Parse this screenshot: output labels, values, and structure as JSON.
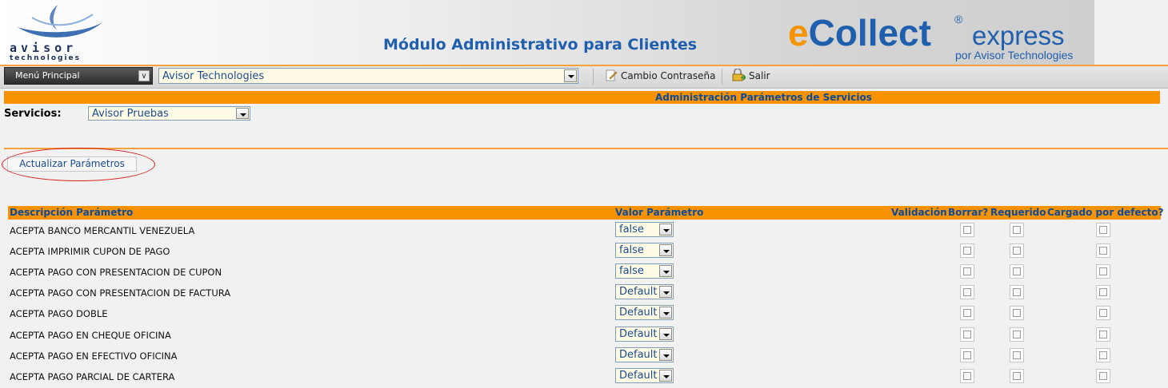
{
  "header": {
    "logo_word": "avisor",
    "logo_sub": "technologies",
    "title": "Módulo Administrativo para Clientes",
    "brand_e": "e",
    "brand_collect": "Collect",
    "brand_reg": "®",
    "brand_express": "express",
    "brand_by": "por Avisor Technologies"
  },
  "toolbar": {
    "menu_label": "Menú Principal",
    "company_select": "Avisor Technologies",
    "change_password": "Cambio Contraseña",
    "exit": "Salir"
  },
  "section_title": "Administración Parámetros de Servicios",
  "services": {
    "label": "Servicios:",
    "selected": "Avisor Pruebas"
  },
  "update_button": "Actualizar Parámetros",
  "table": {
    "headers": {
      "desc": "Descripción Parámetro",
      "value": "Valor Parámetro",
      "validation": "Validación",
      "delete": "Borrar?",
      "required": "Requerido",
      "default_loaded": "Cargado por defecto?"
    },
    "rows": [
      {
        "desc": "ACEPTA BANCO MERCANTIL VENEZUELA",
        "value": "false"
      },
      {
        "desc": "ACEPTA IMPRIMIR CUPON DE PAGO",
        "value": "false"
      },
      {
        "desc": "ACEPTA PAGO CON PRESENTACION DE CUPON",
        "value": "false"
      },
      {
        "desc": "ACEPTA PAGO CON PRESENTACION DE FACTURA",
        "value": "Default"
      },
      {
        "desc": "ACEPTA PAGO DOBLE",
        "value": "Default"
      },
      {
        "desc": "ACEPTA PAGO EN CHEQUE OFICINA",
        "value": "Default"
      },
      {
        "desc": "ACEPTA PAGO EN EFECTIVO OFICINA",
        "value": "Default"
      },
      {
        "desc": "ACEPTA PAGO PARCIAL DE CARTERA",
        "value": "Default"
      }
    ]
  },
  "colors": {
    "accent_orange": "#f99200",
    "header_blue": "#0a4a9e",
    "brand_orange": "#f39400",
    "brand_blue": "#1f5fae"
  }
}
